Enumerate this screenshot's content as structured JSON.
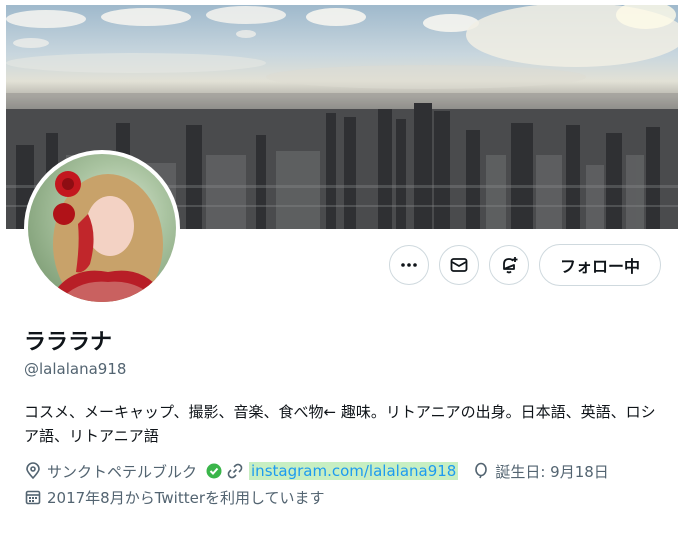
{
  "profile": {
    "display_name": "ラララナ",
    "handle": "@lalalana918",
    "bio": "コスメ、メーキャップ、撮影、音楽、食べ物← 趣味。リトアニアの出身。日本語、英語、ロシア語、リトアニア語",
    "location": "サンクトペテルブルク",
    "website": "instagram.com/lalalana918",
    "birthday": "誕生日: 9月18日",
    "joined": "2017年8月からTwitterを利用しています"
  },
  "actions": {
    "follow_label": "フォロー中"
  },
  "icons": {
    "more": "more-icon",
    "message": "envelope-icon",
    "notify": "bell-plus-icon",
    "location": "location-pin-icon",
    "link": "link-icon",
    "birthday": "balloon-icon",
    "calendar": "calendar-icon",
    "verified": "check-badge-icon"
  },
  "colors": {
    "link": "#1d9bf0",
    "link_highlight": "#c8efc2",
    "secondary_text": "#536471",
    "verified_green": "#3ab54a"
  }
}
